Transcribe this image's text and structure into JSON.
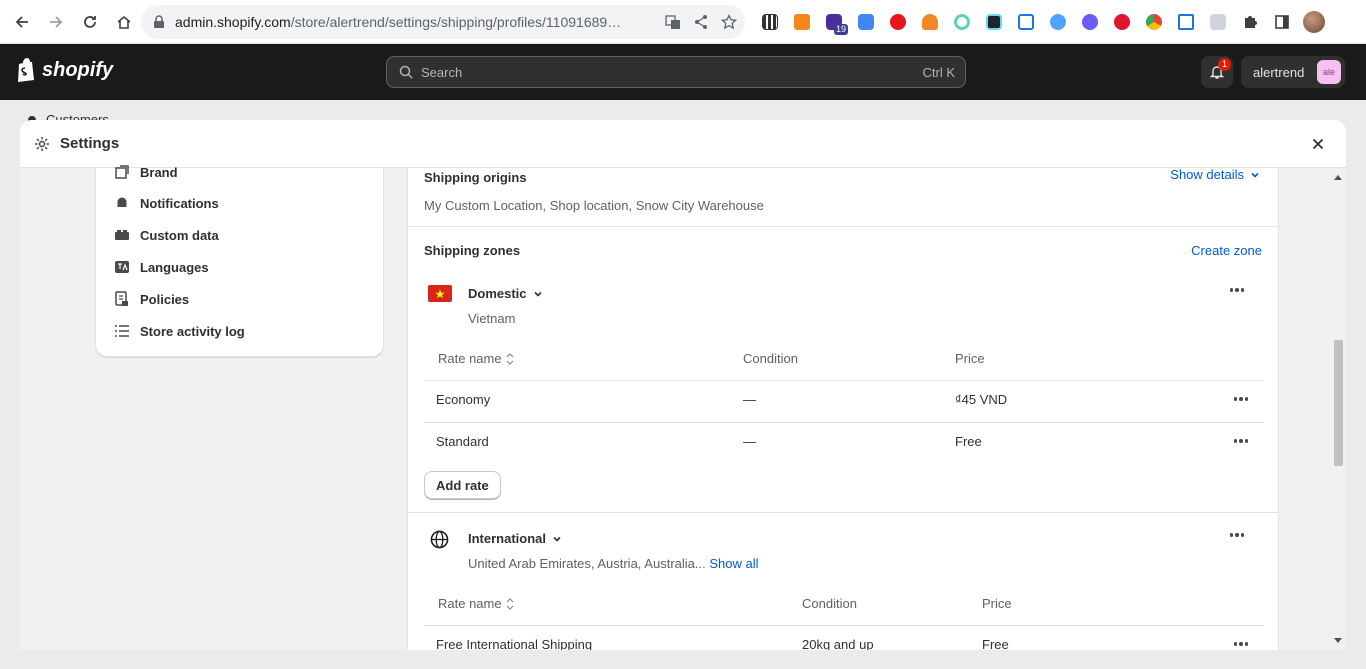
{
  "browser": {
    "url_host": "admin.shopify.com",
    "url_path": "/store/alertrend/settings/shipping/profiles/11091689…",
    "ext_badge": "19"
  },
  "topbar": {
    "brand": "shopify",
    "search_placeholder": "Search",
    "search_shortcut": "Ctrl K",
    "notification_count": "1",
    "store_name": "alertrend",
    "store_avatar": "ale"
  },
  "background": {
    "nav_item": "Customers"
  },
  "modal": {
    "title": "Settings"
  },
  "sidebar": {
    "items": [
      {
        "label": "Brand",
        "icon": "brand-icon"
      },
      {
        "label": "Notifications",
        "icon": "bell-icon"
      },
      {
        "label": "Custom data",
        "icon": "custom-data-icon"
      },
      {
        "label": "Languages",
        "icon": "language-icon"
      },
      {
        "label": "Policies",
        "icon": "policies-icon"
      },
      {
        "label": "Store activity log",
        "icon": "list-icon"
      }
    ]
  },
  "origins": {
    "title": "Shipping origins",
    "show_details": "Show details",
    "locations": "My Custom Location, Shop location, Snow City Warehouse"
  },
  "zones": {
    "title": "Shipping zones",
    "create": "Create zone",
    "domestic": {
      "name": "Domestic",
      "countries": "Vietnam",
      "headers": {
        "rate": "Rate name",
        "condition": "Condition",
        "price": "Price"
      },
      "rows": [
        {
          "name": "Economy",
          "condition": "—",
          "price": "₫45 VND"
        },
        {
          "name": "Standard",
          "condition": "—",
          "price": "Free"
        }
      ],
      "add_rate": "Add rate"
    },
    "international": {
      "name": "International",
      "countries": "United Arab Emirates, Austria, Australia...",
      "show_all": "Show all",
      "headers": {
        "rate": "Rate name",
        "condition": "Condition",
        "price": "Price"
      },
      "rows": [
        {
          "name": "Free International Shipping",
          "condition": "20kg and up",
          "price": "Free"
        }
      ]
    }
  },
  "colors": {
    "link": "#005bd3",
    "topbar": "#1a1a1a",
    "flag_red": "#da251d",
    "flag_star": "#ffff00"
  }
}
